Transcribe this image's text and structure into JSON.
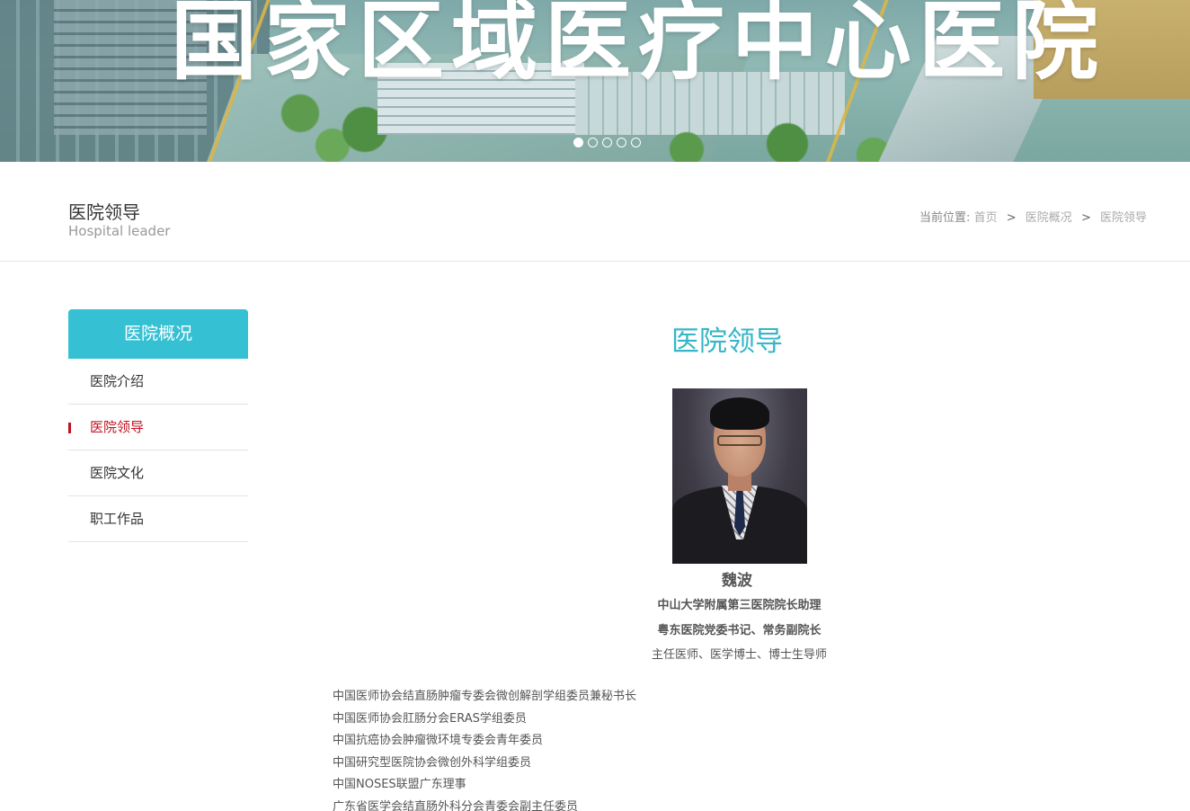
{
  "banner": {
    "title": "国家区域医疗中心医院",
    "slides": 5,
    "active_slide": 1
  },
  "page": {
    "title": "医院领导",
    "subtitle": "Hospital leader"
  },
  "breadcrumb": {
    "prefix": "当前位置:",
    "items": [
      "首页",
      "医院概况",
      "医院领导"
    ],
    "separator": ">"
  },
  "sidebar": {
    "heading": "医院概况",
    "items": [
      {
        "label": "医院介绍",
        "active": false
      },
      {
        "label": "医院领导",
        "active": true
      },
      {
        "label": "医院文化",
        "active": false
      },
      {
        "label": "职工作品",
        "active": false
      }
    ]
  },
  "content": {
    "title": "医院领导",
    "person": {
      "name": "魏波",
      "line1": "中山大学附属第三医院院长助理",
      "line2": "粤东医院党委书记、常务副院长",
      "line3": "主任医师、医学博士、博士生导师"
    },
    "roles": [
      "中国医师协会结直肠肿瘤专委会微创解剖学组委员兼秘书长",
      "中国医师协会肛肠分会ERAS学组委员",
      "中国抗癌协会肿瘤微环境专委会青年委员",
      "中国研究型医院协会微创外科学组委员",
      "中国NOSES联盟广东理事",
      "广东省医学会结直肠外科分会青委会副主任委员"
    ]
  },
  "colors": {
    "accent": "#36c0d3",
    "title_accent": "#36b6c8",
    "active_item": "#c1121f"
  }
}
